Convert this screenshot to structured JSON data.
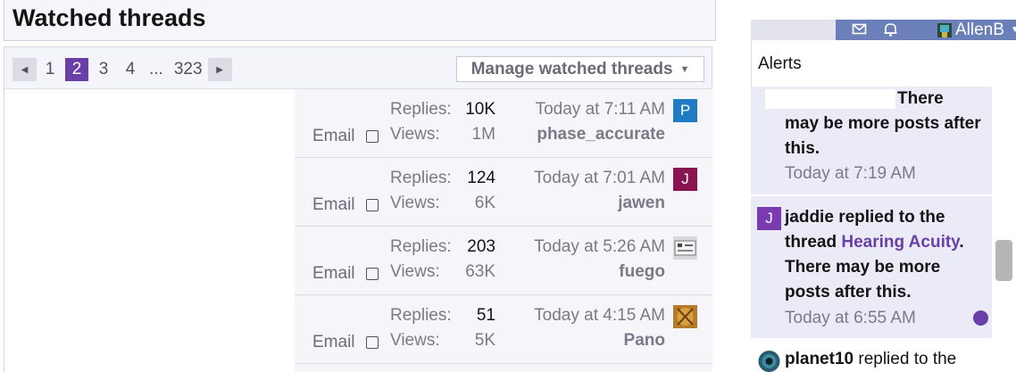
{
  "page": {
    "title": "Watched threads"
  },
  "pagination": {
    "prev_icon": "caret-left-icon",
    "pages": [
      "1",
      "2",
      "3",
      "4"
    ],
    "current": "2",
    "gap": "...",
    "last": "323",
    "next_icon": "caret-right-icon"
  },
  "manage_button": {
    "label": "Manage watched threads",
    "icon": "caret-down-icon"
  },
  "threads": [
    {
      "email_label": "Email",
      "replies_label": "Replies:",
      "replies": "10K",
      "views_label": "Views:",
      "views": "1M",
      "time": "Today at 7:11 AM",
      "user": "phase_accurate",
      "avatar_letter": "P",
      "avatar_color": "#1e7bc4"
    },
    {
      "email_label": "Email",
      "replies_label": "Replies:",
      "replies": "124",
      "views_label": "Views:",
      "views": "6K",
      "time": "Today at 7:01 AM",
      "user": "jawen",
      "avatar_letter": "J",
      "avatar_color": "#8a1450"
    },
    {
      "email_label": "Email",
      "replies_label": "Replies:",
      "replies": "203",
      "views_label": "Views:",
      "views": "63K",
      "time": "Today at 5:26 AM",
      "user": "fuego",
      "avatar_letter": "",
      "avatar_color": "#9a9a9a"
    },
    {
      "email_label": "Email",
      "replies_label": "Replies:",
      "replies": "51",
      "views_label": "Views:",
      "views": "5K",
      "time": "Today at 4:15 AM",
      "user": "Pano",
      "avatar_letter": "",
      "avatar_color": "#a0702a"
    }
  ],
  "navbar": {
    "mail_icon": "mail-icon",
    "bell_icon": "bell-icon",
    "username": "AllenB",
    "caret_icon": "caret-down-icon",
    "bar_color": "#6b80b8"
  },
  "alerts": {
    "heading": "Alerts",
    "items": [
      {
        "lead": "There",
        "text": "may be more posts after this.",
        "time": "Today at 7:19 AM"
      },
      {
        "avatar_letter": "J",
        "avatar_color": "#7a3ab0",
        "user": "jaddie",
        "verb": "replied to the thread",
        "thread": "Hearing Acuity",
        "suffix": ". There may be more posts after this.",
        "time": "Today at 6:55 AM",
        "unread": true
      },
      {
        "user": "planet10",
        "verb": "replied to the"
      }
    ]
  }
}
